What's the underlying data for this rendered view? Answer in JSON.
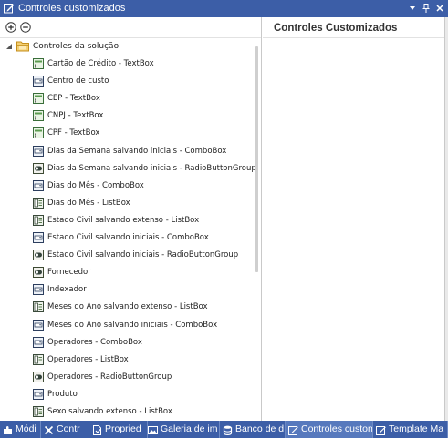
{
  "window": {
    "title": "Controles customizados"
  },
  "tree": {
    "root_label": "Controles da solução",
    "items": [
      {
        "label": "Cartão de Crédito - TextBox",
        "icon": "textbox-icon"
      },
      {
        "label": "Centro de custo",
        "icon": "combobox-icon"
      },
      {
        "label": "CEP - TextBox",
        "icon": "textbox-icon"
      },
      {
        "label": "CNPJ - TextBox",
        "icon": "textbox-icon"
      },
      {
        "label": "CPF - TextBox",
        "icon": "textbox-icon"
      },
      {
        "label": "Dias da Semana salvando iniciais - ComboBox",
        "icon": "combobox-icon"
      },
      {
        "label": "Dias da Semana salvando iniciais - RadioButtonGroup",
        "icon": "radiobutton-icon"
      },
      {
        "label": "Dias do Mês - ComboBox",
        "icon": "combobox-icon"
      },
      {
        "label": "Dias do Mês - ListBox",
        "icon": "listbox-icon"
      },
      {
        "label": "Estado Civil salvando extenso - ListBox",
        "icon": "listbox-icon"
      },
      {
        "label": "Estado Civil salvando iniciais - ComboBox",
        "icon": "combobox-icon"
      },
      {
        "label": "Estado Civil salvando iniciais - RadioButtonGroup",
        "icon": "radiobutton-icon"
      },
      {
        "label": "Fornecedor",
        "icon": "radiobutton-icon"
      },
      {
        "label": "Indexador",
        "icon": "combobox-icon"
      },
      {
        "label": "Meses do Ano salvando extenso - ListBox",
        "icon": "listbox-icon"
      },
      {
        "label": "Meses do Ano salvando iniciais - ComboBox",
        "icon": "combobox-icon"
      },
      {
        "label": "Operadores - ComboBox",
        "icon": "combobox-icon"
      },
      {
        "label": "Operadores - ListBox",
        "icon": "listbox-icon"
      },
      {
        "label": "Operadores - RadioButtonGroup",
        "icon": "radiobutton-icon"
      },
      {
        "label": "Produto",
        "icon": "combobox-icon"
      },
      {
        "label": "Sexo salvando extenso - ListBox",
        "icon": "listbox-icon"
      }
    ]
  },
  "detail": {
    "heading": "Controles Customizados"
  },
  "tabs": [
    {
      "label": "Módi",
      "icon": "puzzle-icon",
      "active": false
    },
    {
      "label": "Contr",
      "icon": "tools-icon",
      "active": false
    },
    {
      "label": "Propried",
      "icon": "properties-icon",
      "active": false
    },
    {
      "label": "Galeria de im",
      "icon": "image-gallery-icon",
      "active": false
    },
    {
      "label": "Banco de d",
      "icon": "database-icon",
      "active": false
    },
    {
      "label": "Controles custon",
      "icon": "custom-controls-icon",
      "active": true
    },
    {
      "label": "Template Ma",
      "icon": "template-icon",
      "active": false
    }
  ],
  "colors": {
    "titlebar": "#3c5ea7",
    "active_tab": "#5779bd",
    "folder": "#e8b84a"
  }
}
